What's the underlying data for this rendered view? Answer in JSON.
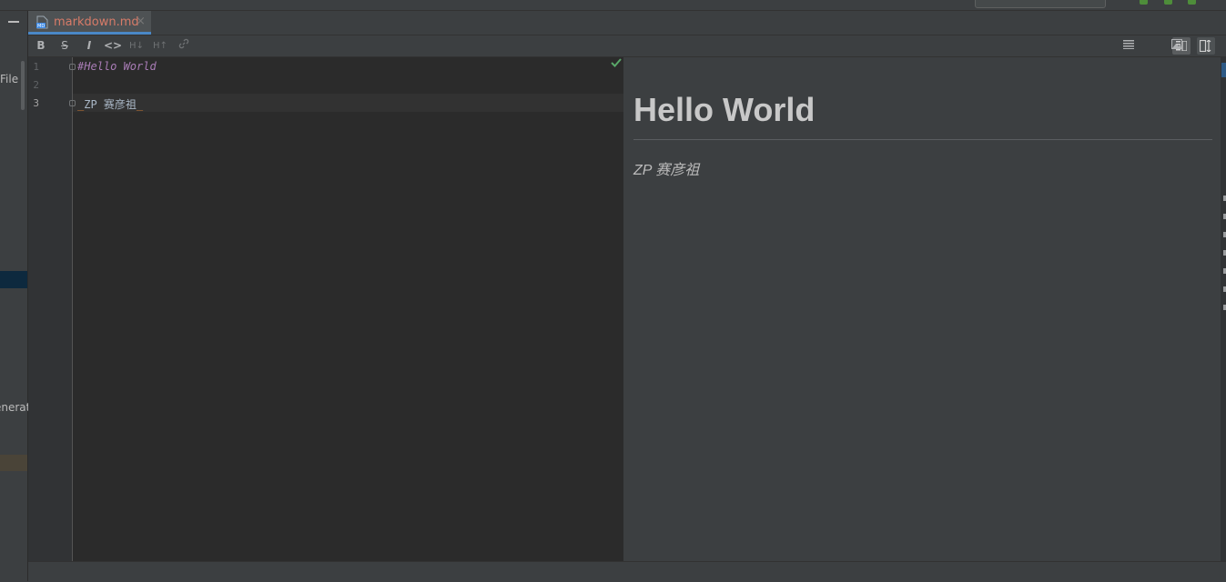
{
  "left_panel": {
    "label_file": "File",
    "label_generate": "enerat"
  },
  "tabs": [
    {
      "label": "markdown.md",
      "close": "×",
      "active": true
    }
  ],
  "toolbar": {
    "bold": "B",
    "strike": "S",
    "italic": "I",
    "code": "<>",
    "header_down": "H↓",
    "header_up": "H↑"
  },
  "editor": {
    "line_numbers": [
      "1",
      "2",
      "3"
    ],
    "lines": [
      "#Hello World",
      "",
      "_ZP 赛彦祖_"
    ],
    "line3_text": "ZP 赛彦祖",
    "line3_open": "_",
    "line3_close": "_",
    "status": "ok"
  },
  "preview": {
    "heading": "Hello World",
    "paragraph": "ZP 赛彦祖"
  },
  "colors": {
    "accent": "#4a88c7",
    "tab_text": "#d77b68",
    "heading_md": "#a97cb6",
    "ok": "#59a869"
  }
}
